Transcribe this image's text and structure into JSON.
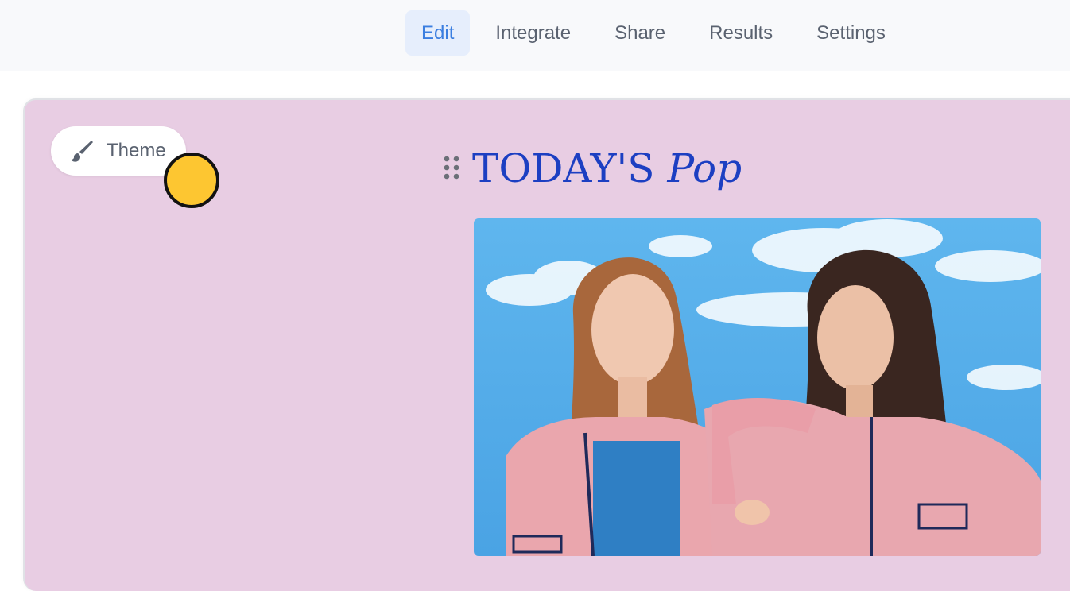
{
  "nav": {
    "tabs": [
      {
        "label": "Edit",
        "active": true
      },
      {
        "label": "Integrate",
        "active": false
      },
      {
        "label": "Share",
        "active": false
      },
      {
        "label": "Results",
        "active": false
      },
      {
        "label": "Settings",
        "active": false
      }
    ]
  },
  "theme_button": {
    "label": "Theme",
    "icon": "paintbrush-icon"
  },
  "heading": {
    "part1": "TODAY'S",
    "part2": "Pop"
  },
  "colors": {
    "accent": "#3b7ee0",
    "canvas": "#e8cde3",
    "heading": "#1c3fc2",
    "cursor": "#fdc631"
  }
}
